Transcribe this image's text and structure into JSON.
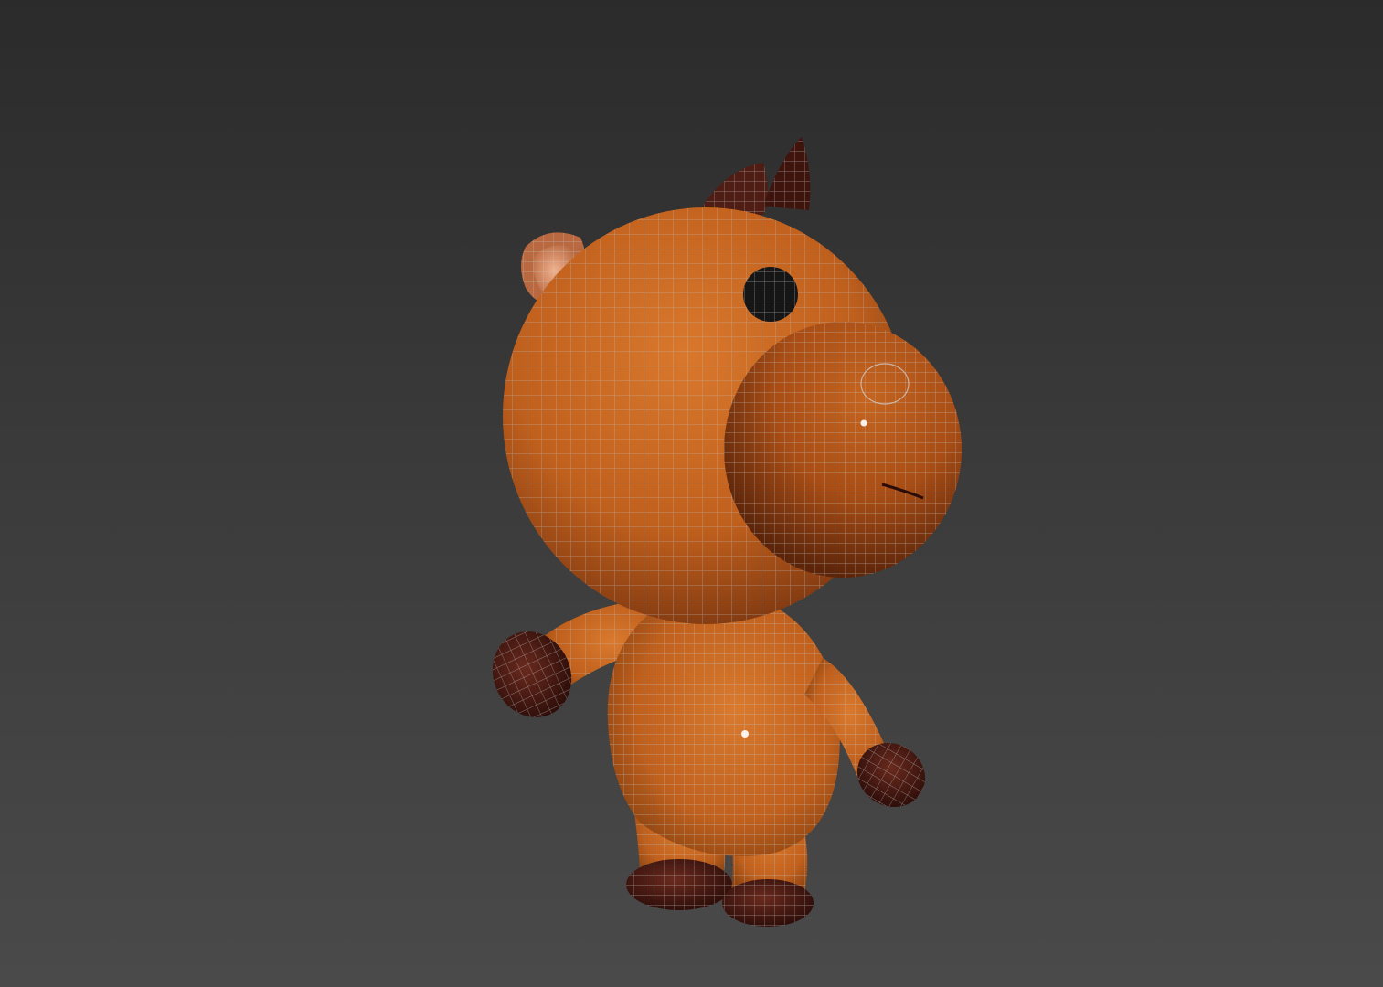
{
  "viewport": {
    "background_top": "#2b2b2b",
    "background_bottom": "#4a4a4a"
  },
  "model": {
    "subject": "cartoon-horse",
    "body_color": "#c8651e",
    "hoof_color": "#4a1a14",
    "inner_ear_color": "#e8a27c",
    "eye_color": "#161616",
    "wireframe_color": "#b9b9b9",
    "wireframe_visible": true
  }
}
